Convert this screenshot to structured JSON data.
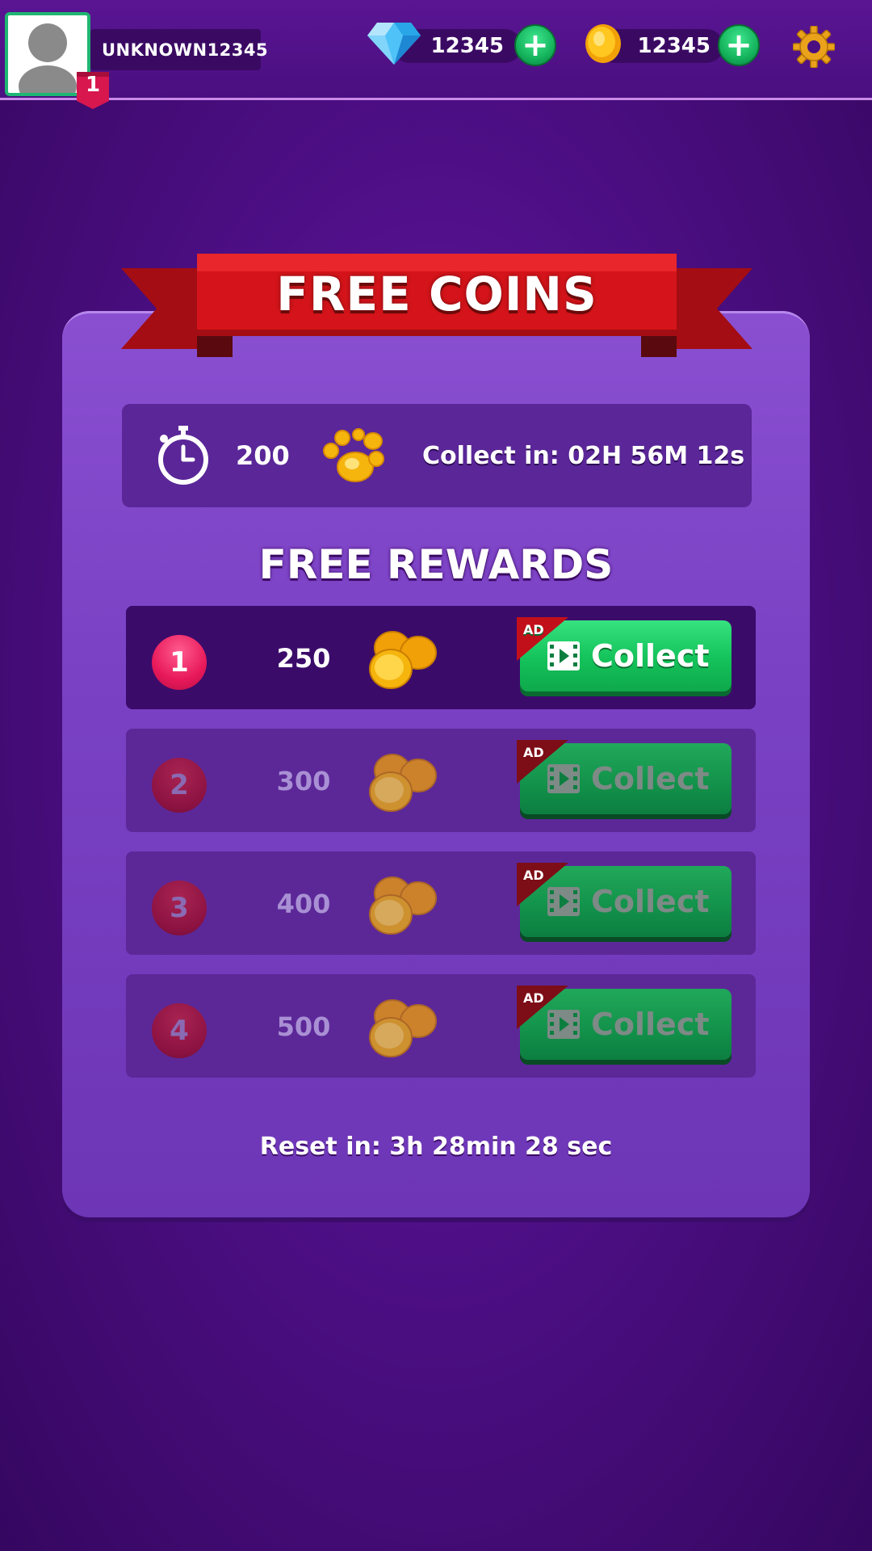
{
  "header": {
    "username": "UNKNOWN12345",
    "level": "1",
    "gems": "12345",
    "coins": "12345"
  },
  "panel": {
    "title": "FREE COINS",
    "timer_amount": "200",
    "collect_label": "Collect in:  02H 56M 12s",
    "rewards_heading": "FREE REWARDS",
    "reset_label": "Reset in: 3h 28min 28 sec"
  },
  "rewards": [
    {
      "num": "1",
      "amount": "250",
      "button": "Collect",
      "ad": "AD",
      "state": "active"
    },
    {
      "num": "2",
      "amount": "300",
      "button": "Collect",
      "ad": "AD",
      "state": "locked"
    },
    {
      "num": "3",
      "amount": "400",
      "button": "Collect",
      "ad": "AD",
      "state": "locked"
    },
    {
      "num": "4",
      "amount": "500",
      "button": "Collect",
      "ad": "AD",
      "state": "locked"
    }
  ],
  "colors": {
    "background": "#4e0f86",
    "panel": "#7a41c4",
    "ribbon": "#d4141a",
    "collect_green": "#14c25a",
    "number_pink": "#e8195a"
  }
}
